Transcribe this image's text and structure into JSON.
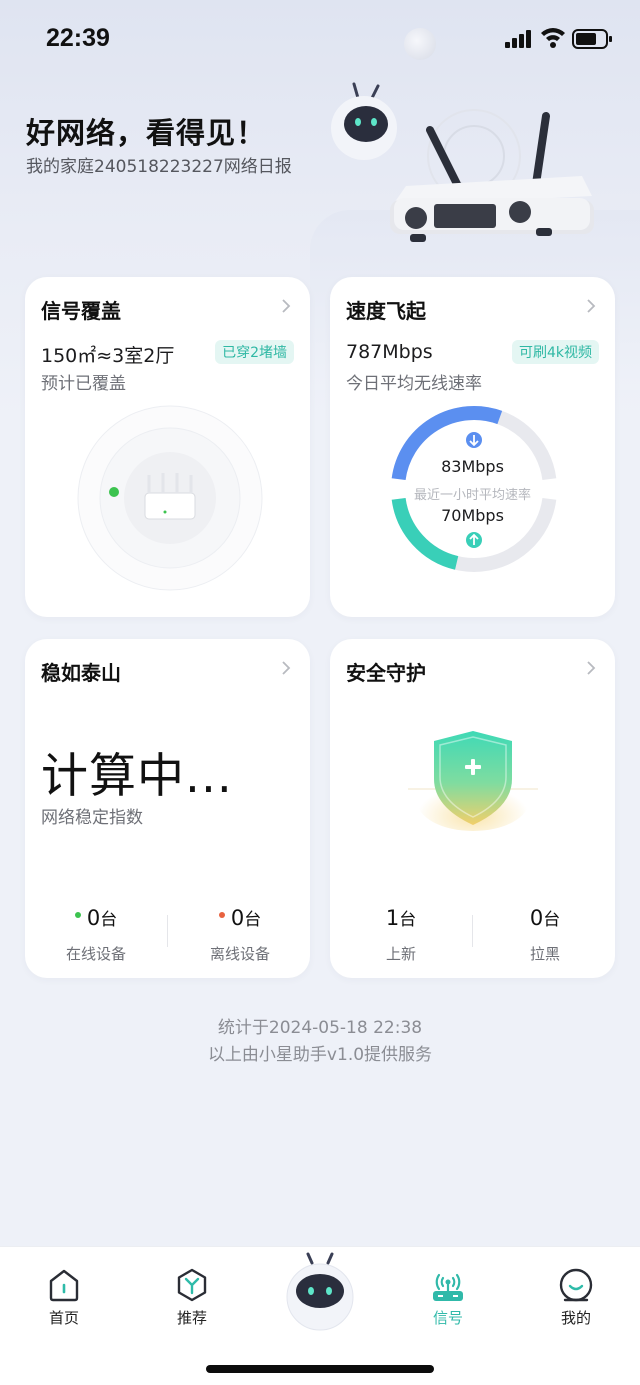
{
  "status_bar": {
    "time": "22:39"
  },
  "hero": {
    "title": "好网络，看得见！",
    "subtitle": "我的家庭240518223227网络日报"
  },
  "cards": {
    "signal": {
      "title": "信号覆盖",
      "coverage": "150㎡≈3室2厅",
      "tag": "已穿2堵墙",
      "subtitle": "预计已覆盖"
    },
    "speed": {
      "title": "速度飞起",
      "rate": "787Mbps",
      "tag": "可刷4k视频",
      "subtitle": "今日平均无线速率",
      "download": "83Mbps",
      "ring_caption": "最近一小时平均速率",
      "upload": "70Mbps",
      "download_fraction": 0.62,
      "upload_fraction": 0.42
    },
    "stable": {
      "title": "稳如泰山",
      "value": "计算中...",
      "subtitle": "网络稳定指数",
      "online_count": "0",
      "online_unit": "台",
      "online_label": "在线设备",
      "offline_count": "0",
      "offline_unit": "台",
      "offline_label": "离线设备"
    },
    "security": {
      "title": "安全守护",
      "new_count": "1",
      "new_unit": "台",
      "new_label": "上新",
      "block_count": "0",
      "block_unit": "台",
      "block_label": "拉黑"
    }
  },
  "footer": {
    "stats_time": "统计于2024-05-18  22:38",
    "provider": "以上由小星助手v1.0提供服务"
  },
  "tabbar": {
    "items": [
      {
        "label": "首页",
        "icon": "home-icon"
      },
      {
        "label": "推荐",
        "icon": "recommend-icon"
      },
      {
        "label": "信号",
        "icon": "signal-router-icon",
        "active": true
      },
      {
        "label": "我的",
        "icon": "profile-icon"
      }
    ]
  },
  "colors": {
    "accent": "#30b9a9",
    "download_ring": "#5b8ff0",
    "upload_ring": "#39cfb8",
    "online_dot": "#3cc34f",
    "offline_dot": "#e8623f"
  }
}
